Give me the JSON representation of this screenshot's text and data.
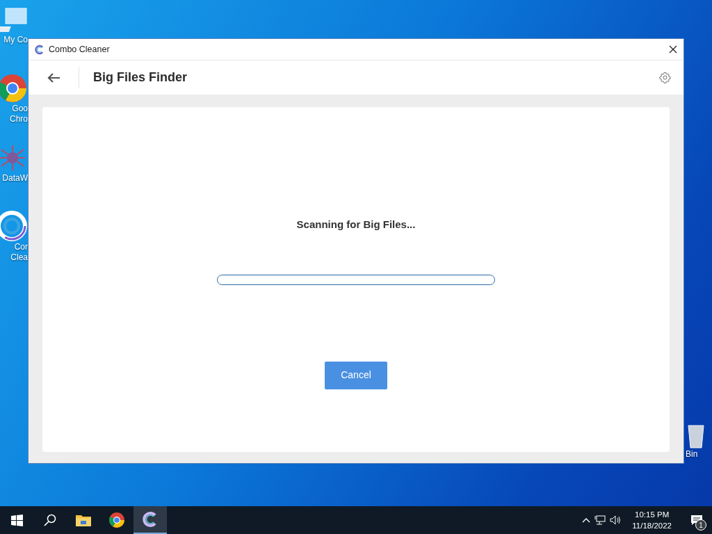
{
  "desktop_icons": [
    {
      "kind": "computer",
      "lines": [
        "My Co"
      ]
    },
    {
      "kind": "browser",
      "lines": [
        "Goo",
        "Chro"
      ]
    },
    {
      "kind": "network",
      "lines": [
        "DataW"
      ]
    },
    {
      "kind": "cleaner",
      "lines": [
        "Cor",
        "Clea"
      ]
    },
    {
      "kind": "bin",
      "lines": [
        "Bin"
      ]
    }
  ],
  "window": {
    "title": "Combo Cleaner",
    "header": {
      "title": "Big Files Finder"
    },
    "scan": {
      "message": "Scanning for Big Files...",
      "progress": {
        "level": 0
      },
      "cancel_button": "Cancel"
    }
  },
  "taskbar": {
    "apps": [
      {
        "kind": "explorer",
        "selected": false
      },
      {
        "kind": "browser",
        "selected": false
      },
      {
        "kind": "cleaner",
        "selected": true
      }
    ],
    "clock": {
      "time": "10:15 PM",
      "date": "11/18/2022"
    },
    "notifications": {
      "count": "1"
    }
  }
}
